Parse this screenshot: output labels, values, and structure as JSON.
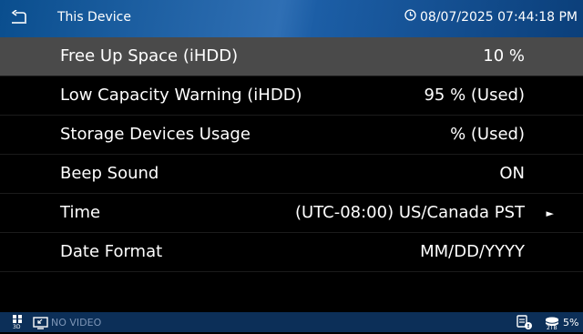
{
  "header": {
    "title": "This Device",
    "datetime": "08/07/2025 07:44:18 PM"
  },
  "settings": [
    {
      "label": "Free Up Space (iHDD)",
      "value": "10 %",
      "selected": true
    },
    {
      "label": "Low Capacity Warning (iHDD)",
      "value": "95 % (Used)"
    },
    {
      "label": "Storage Devices Usage",
      "value": "% (Used)"
    },
    {
      "label": "Beep Sound",
      "value": "ON"
    },
    {
      "label": "Time",
      "value": "(UTC-08:00) US/Canada PST",
      "has_arrow": true
    },
    {
      "label": "Date Format",
      "value": "MM/DD/YYYY"
    }
  ],
  "status_bar": {
    "grid_label": "3D",
    "no_video": "NO VIDEO",
    "hdd_sub": "2TB",
    "usage": "5%"
  },
  "icons": {
    "back": "back-arrow-icon",
    "clock": "clock-icon",
    "grid": "multiview-grid-icon",
    "screen": "screen-icon",
    "hdd": "hdd-status-icon",
    "storage": "storage-icon"
  },
  "colors": {
    "header": "#1c5ea6",
    "selected_row": "#4a4a4a",
    "status_bar": "#0c2f58"
  }
}
